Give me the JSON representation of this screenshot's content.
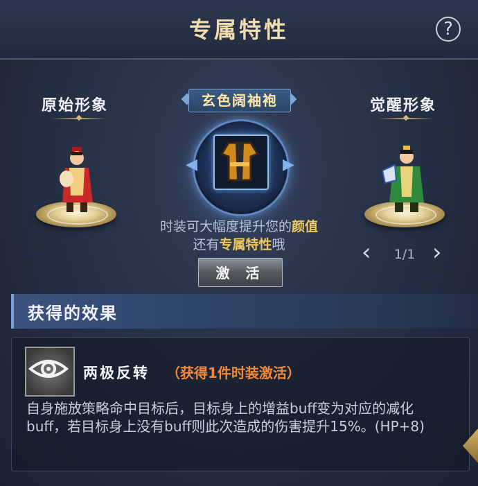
{
  "header": {
    "title": "专属特性",
    "help_label": "?"
  },
  "left": {
    "label": "原始形象"
  },
  "right": {
    "label": "觉醒形象",
    "pager": "1/1"
  },
  "costume": {
    "name": "玄色阔袖袍",
    "desc_line1_a": "时装可大幅度提升您的",
    "desc_line1_b": "颜值",
    "desc_line2_a": "还有",
    "desc_line2_b": "专属特性",
    "desc_line2_c": "哦",
    "activate_label": "激 活"
  },
  "effects": {
    "section_title": "获得的效果",
    "skill_name": "两极反转",
    "skill_condition": "（获得1件时装激活）",
    "skill_description": "自身施放策略命中目标后，目标身上的增益buff变为对应的减化buff，若目标身上没有buff则此次造成的伤害提升15%。(HP+8)"
  },
  "colors": {
    "title": "#f0dcae",
    "highlight": "#f0c860",
    "condition": "#f08a3a"
  }
}
